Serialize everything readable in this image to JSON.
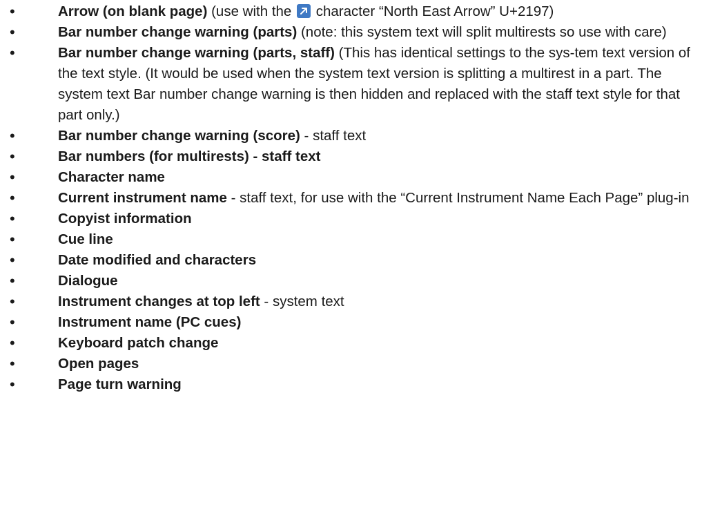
{
  "items": [
    {
      "bold": "Arrow (on blank page)",
      "pre_icon": " (use with the ",
      "icon": "north-east-arrow",
      "post_icon": " character “North East Arrow” U+2197)"
    },
    {
      "bold": "Bar number change warning (parts)",
      "rest": " (note: this system text will split multirests so use with care)"
    },
    {
      "bold": "Bar number change warning (parts, staff)",
      "rest": " (This has identical settings to the sys-tem text version of the text style. (It would be used when the system text version is splitting a multirest in a part. The system text Bar number change warning is then hidden and replaced with the staff text style for that part only.)"
    },
    {
      "bold": "Bar number change warning (score)",
      "rest": " - staff text"
    },
    {
      "bold": "Bar numbers (for multirests) - staff text",
      "rest": ""
    },
    {
      "bold": "Character name",
      "rest": ""
    },
    {
      "bold": "Current instrument name",
      "rest": " - staff text, for use with the “Current Instrument Name Each Page” plug-in"
    },
    {
      "bold": "Copyist information",
      "rest": ""
    },
    {
      "bold": "Cue line",
      "rest": ""
    },
    {
      "bold": "Date modified and characters",
      "rest": ""
    },
    {
      "bold": "Dialogue",
      "rest": ""
    },
    {
      "bold": "Instrument changes at top left",
      "rest": " - system text"
    },
    {
      "bold": "Instrument name (PC cues)",
      "rest": ""
    },
    {
      "bold": "Keyboard patch change",
      "rest": ""
    },
    {
      "bold": "Open pages",
      "rest": ""
    },
    {
      "bold": "Page turn warning",
      "rest": ""
    }
  ],
  "bullet": "•",
  "colors": {
    "arrow_icon_bg": "#3f79c4",
    "text": "#1a1a1a"
  }
}
